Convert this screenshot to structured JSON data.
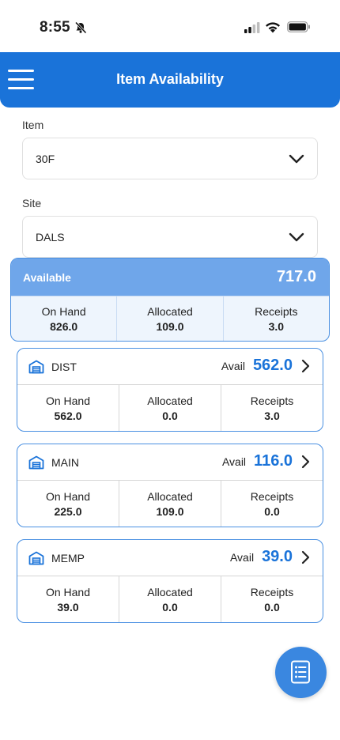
{
  "status_bar": {
    "time": "8:55"
  },
  "header": {
    "title": "Item Availability"
  },
  "form": {
    "item_label": "Item",
    "item_value": "30F",
    "site_label": "Site",
    "site_value": "DALS"
  },
  "summary": {
    "label": "Available",
    "value": "717.0",
    "on_hand_label": "On Hand",
    "on_hand": "826.0",
    "allocated_label": "Allocated",
    "allocated": "109.0",
    "receipts_label": "Receipts",
    "receipts": "3.0"
  },
  "sites": [
    {
      "name": "DIST",
      "avail_label": "Avail",
      "avail": "562.0",
      "on_hand_label": "On Hand",
      "on_hand": "562.0",
      "allocated_label": "Allocated",
      "allocated": "0.0",
      "receipts_label": "Receipts",
      "receipts": "3.0"
    },
    {
      "name": "MAIN",
      "avail_label": "Avail",
      "avail": "116.0",
      "on_hand_label": "On Hand",
      "on_hand": "225.0",
      "allocated_label": "Allocated",
      "allocated": "109.0",
      "receipts_label": "Receipts",
      "receipts": "0.0"
    },
    {
      "name": "MEMP",
      "avail_label": "Avail",
      "avail": "39.0",
      "on_hand_label": "On Hand",
      "on_hand": "39.0",
      "allocated_label": "Allocated",
      "allocated": "0.0",
      "receipts_label": "Receipts",
      "receipts": "0.0"
    }
  ],
  "icons": {
    "menu": "hamburger-menu-icon",
    "chevron": "chevron-down-icon",
    "warehouse": "warehouse-icon",
    "arrow": "chevron-right-icon",
    "fab": "list-icon"
  },
  "colors": {
    "primary": "#1a73d9",
    "summary_head": "#6fa6ea",
    "fab": "#3a87e0"
  }
}
